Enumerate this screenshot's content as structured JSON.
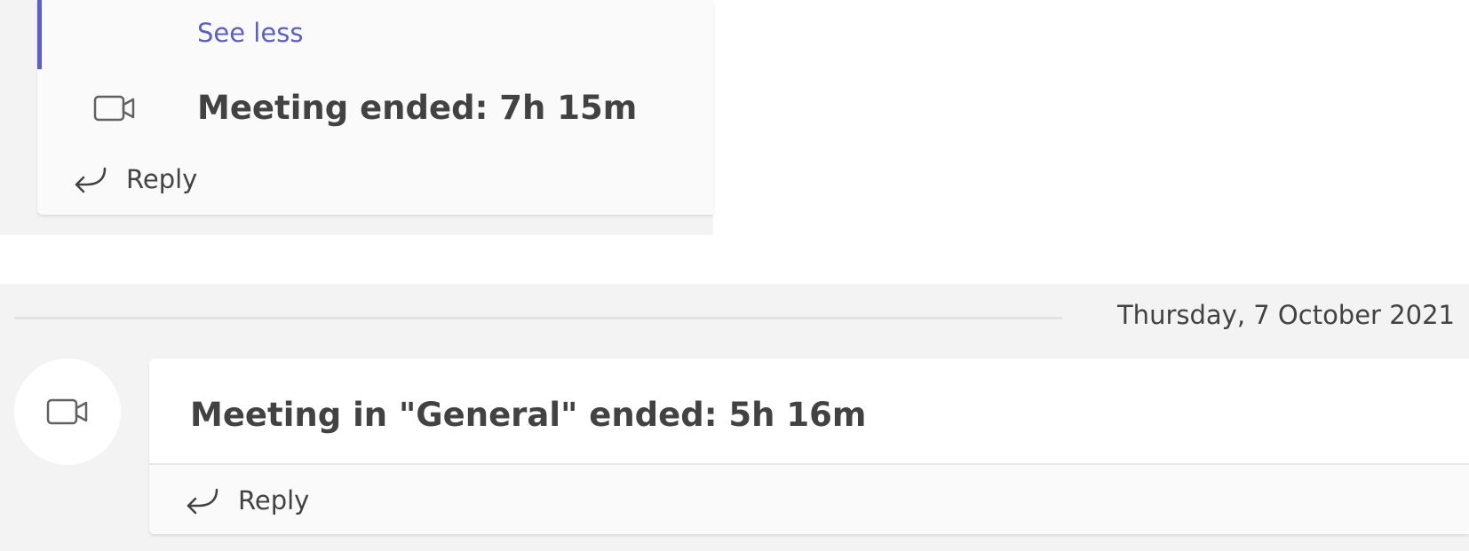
{
  "top_thread": {
    "see_less_label": "See less",
    "meeting_text": "Meeting ended: 7h 15m",
    "reply_label": "Reply"
  },
  "date_divider": {
    "date": "Thursday, 7 October 2021"
  },
  "main_thread": {
    "meeting_text": "Meeting in \"General\" ended: 5h 16m",
    "reply_label": "Reply"
  },
  "icons": {
    "camera": "video-camera-icon",
    "reply": "reply-arrow-icon"
  },
  "colors": {
    "accent": "#5b5fc7",
    "text": "#424242",
    "background": "#f3f3f3"
  }
}
